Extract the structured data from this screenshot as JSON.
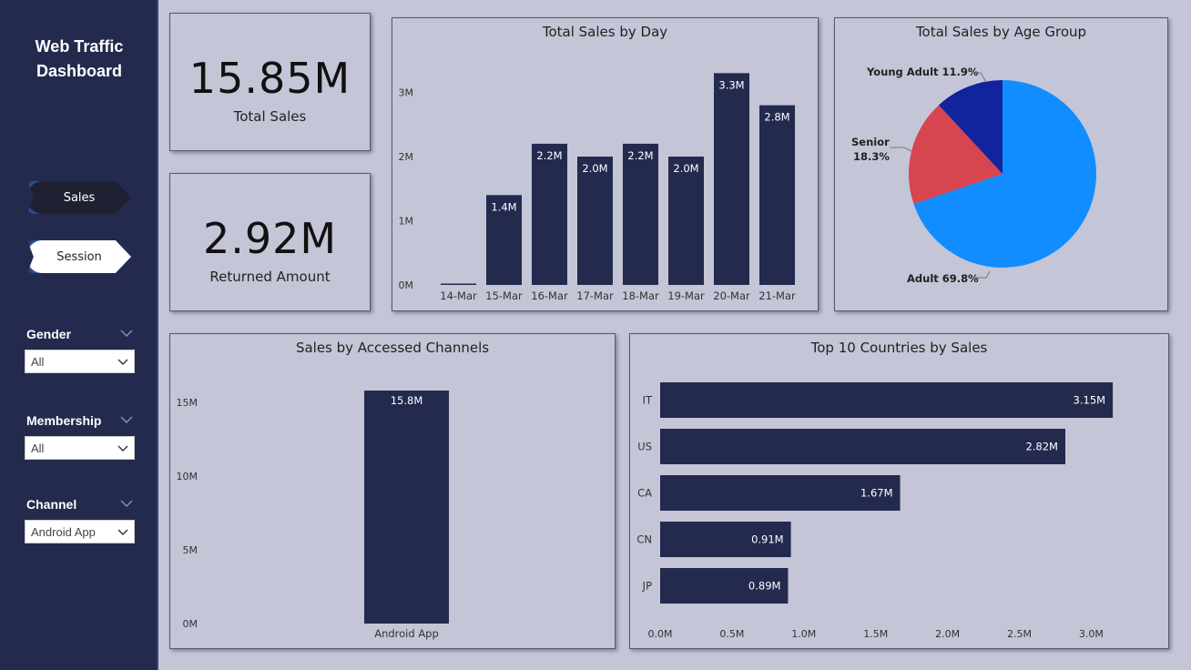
{
  "sidebar": {
    "title": "Web Traffic\nDashboard",
    "nav": {
      "sales": "Sales",
      "session": "Session"
    },
    "filters": [
      {
        "label": "Gender",
        "value": "All"
      },
      {
        "label": "Membership",
        "value": "All"
      },
      {
        "label": "Channel",
        "value": "Android App"
      }
    ]
  },
  "kpis": {
    "total_sales": {
      "value": "15.85M",
      "label": "Total Sales"
    },
    "returned": {
      "value": "2.92M",
      "label": "Returned Amount"
    }
  },
  "colors": {
    "bar": "#232a4e",
    "adult": "#118dff",
    "senior": "#d64550",
    "young": "#12239e"
  },
  "chart_data": [
    {
      "type": "bar",
      "title": "Total Sales by Day",
      "categories": [
        "14-Mar",
        "15-Mar",
        "16-Mar",
        "17-Mar",
        "18-Mar",
        "19-Mar",
        "20-Mar",
        "21-Mar"
      ],
      "values": [
        0.02,
        1.4,
        2.2,
        2.0,
        2.2,
        2.0,
        3.3,
        2.8
      ],
      "labels": [
        "",
        "1.4M",
        "2.2M",
        "2.0M",
        "2.2M",
        "2.0M",
        "3.3M",
        "2.8M"
      ],
      "yticks": [
        "0M",
        "1M",
        "2M",
        "3M"
      ],
      "ylim": [
        0,
        3.4
      ]
    },
    {
      "type": "pie",
      "title": "Total Sales by Age Group",
      "slices": [
        {
          "name": "Adult",
          "value": 69.8,
          "label": "Adult 69.8%"
        },
        {
          "name": "Senior",
          "value": 18.3,
          "label": "Senior",
          "label2": "18.3%"
        },
        {
          "name": "Young Adult",
          "value": 11.9,
          "label": "Young Adult 11.9%"
        }
      ]
    },
    {
      "type": "bar",
      "title": "Sales by Accessed Channels",
      "categories": [
        "Android App"
      ],
      "values": [
        15.8
      ],
      "labels": [
        "15.8M"
      ],
      "yticks": [
        "0M",
        "5M",
        "10M",
        "15M"
      ],
      "ylim": [
        0,
        16.5
      ]
    },
    {
      "type": "bar",
      "orientation": "horizontal",
      "title": "Top 10 Countries by Sales",
      "categories": [
        "IT",
        "US",
        "CA",
        "CN",
        "JP"
      ],
      "values": [
        3.15,
        2.82,
        1.67,
        0.91,
        0.89
      ],
      "labels": [
        "3.15M",
        "2.82M",
        "1.67M",
        "0.91M",
        "0.89M"
      ],
      "xticks": [
        "0.0M",
        "0.5M",
        "1.0M",
        "1.5M",
        "2.0M",
        "2.5M",
        "3.0M"
      ],
      "xlim": [
        0,
        3.0
      ]
    }
  ]
}
